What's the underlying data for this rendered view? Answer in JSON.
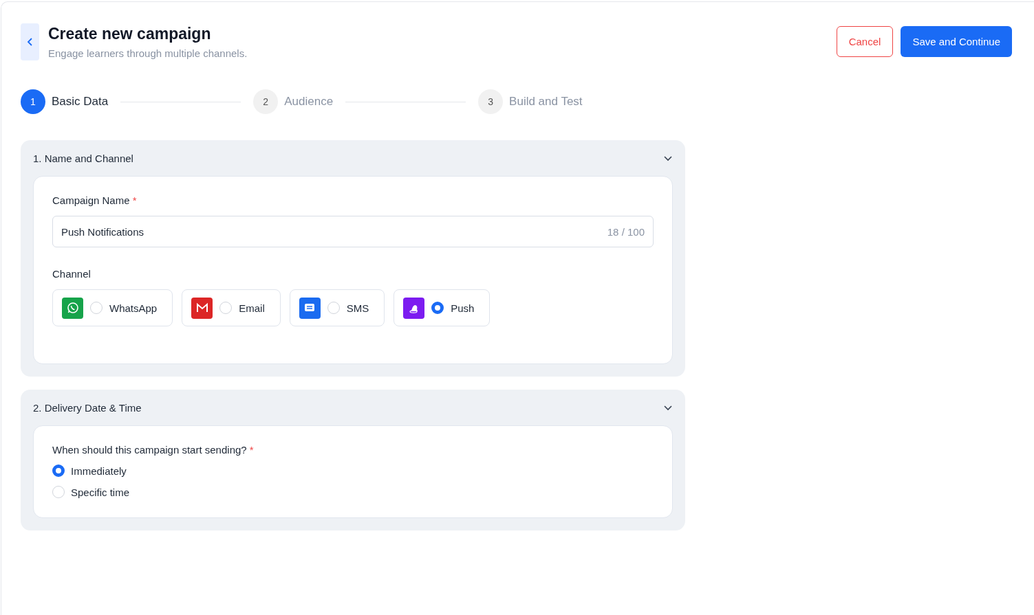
{
  "header": {
    "title": "Create new campaign",
    "subtitle": "Engage learners through multiple channels.",
    "cancel": "Cancel",
    "save": "Save and Continue"
  },
  "steps": [
    {
      "number": "1",
      "label": "Basic Data",
      "selected": true
    },
    {
      "number": "2",
      "label": "Audience",
      "selected": false
    },
    {
      "number": "3",
      "label": "Build and Test",
      "selected": false
    }
  ],
  "sections": [
    {
      "kind": "name_channel",
      "title": "1. Name and Channel",
      "expanded": true,
      "name_label": "Campaign Name",
      "required_mark": "*",
      "name_value": "Push Notifications",
      "char_count": "18 / 100",
      "channel_label": "Channel",
      "channels": [
        {
          "kind": "whatsapp",
          "label": "WhatsApp",
          "color": "#16a34a",
          "selected": false
        },
        {
          "kind": "email",
          "label": "Email",
          "color": "#dc2626",
          "selected": false
        },
        {
          "kind": "sms",
          "label": "SMS",
          "color": "#1a6bf0",
          "selected": false
        },
        {
          "kind": "push",
          "label": "Push",
          "color": "#7c1cf0",
          "selected": true
        }
      ]
    },
    {
      "kind": "delivery",
      "title": "2. Delivery Date & Time",
      "expanded": true,
      "question": "When should this campaign start sending?",
      "required_mark": "*",
      "options": [
        {
          "label": "Immediately",
          "selected": true
        },
        {
          "label": "Specific time",
          "selected": false
        }
      ]
    }
  ]
}
